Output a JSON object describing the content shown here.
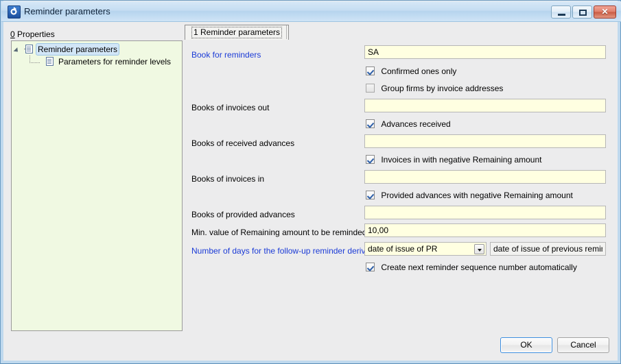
{
  "window": {
    "title": "Reminder parameters",
    "icon": "app-swirl-icon",
    "minimize_glyph": "minimize-icon",
    "maximize_glyph": "maximize-icon",
    "close_glyph": "✕"
  },
  "left_panel": {
    "header_accel": "0",
    "header_rest": " Properties",
    "tree": [
      {
        "label": "Reminder parameters",
        "level": 1,
        "selected": true,
        "icon": "document-icon"
      },
      {
        "label": "Parameters for reminder levels",
        "level": 2,
        "selected": false,
        "icon": "document-icon"
      }
    ]
  },
  "tabs": [
    {
      "label": "1 Reminder parameters",
      "active": true
    }
  ],
  "form": {
    "fields": [
      {
        "label": "Book for reminders",
        "link": true,
        "value": "SA",
        "placeholder": ""
      },
      {
        "label": "Books of invoices out",
        "link": false,
        "value": "",
        "placeholder": ""
      },
      {
        "label": "Books of received advances",
        "link": false,
        "value": "",
        "placeholder": ""
      },
      {
        "label": "Books of invoices in",
        "link": false,
        "value": "",
        "placeholder": ""
      },
      {
        "label": "Books of provided advances",
        "link": false,
        "value": "",
        "placeholder": ""
      },
      {
        "label": "Min. value of Remaining amount to be reminded",
        "link": false,
        "value": "10,00",
        "placeholder": ""
      }
    ],
    "checkboxes": [
      {
        "label": "Confirmed ones only",
        "checked": true
      },
      {
        "label": "Group firms by invoice addresses",
        "checked": false
      },
      {
        "label": "Advances received",
        "checked": true
      },
      {
        "label": "Invoices in with negative Remaining amount",
        "checked": true
      },
      {
        "label": "Provided advances with negative Remaining amount",
        "checked": true
      },
      {
        "label": "Create next reminder sequence number automatically",
        "checked": true
      }
    ],
    "derive_row": {
      "label": "Number of days for the follow-up reminder derive...",
      "link": true,
      "selected_option": "date of issue of PR",
      "options": [
        "date of issue of PR"
      ],
      "readonly_value": "date of issue of previous reminder"
    }
  },
  "footer": {
    "ok_label": "OK",
    "cancel_label": "Cancel"
  },
  "colors": {
    "field_background": "#ffffe1",
    "tree_background": "#f0f9e2",
    "link_text": "#1a3ad6",
    "dialog_background": "#ececed",
    "titlebar_blue": "#bfd9ee",
    "close_red": "#c95a42"
  }
}
